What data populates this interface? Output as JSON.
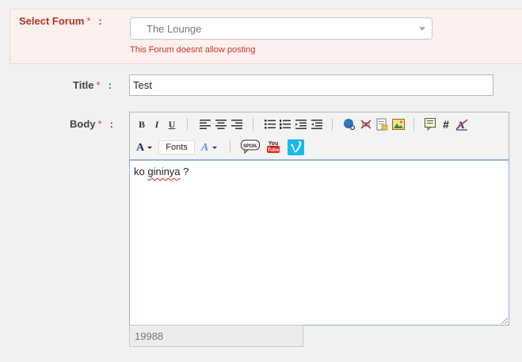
{
  "forum": {
    "label": "Select Forum",
    "required": "*",
    "colon": ":",
    "selected": "The Lounge",
    "error": "This Forum doesnt allow posting"
  },
  "title": {
    "label": "Title",
    "required": "*",
    "colon": ":",
    "value": "Test"
  },
  "body": {
    "label": "Body",
    "required": "*",
    "colon": ":",
    "content": "ko gininya ?",
    "misspelled": "gininya"
  },
  "toolbar": {
    "bold": "B",
    "italic": "I",
    "underline": "U",
    "hash": "#",
    "fonts": "Fonts",
    "spoil": "SPOIL",
    "youtube_top": "You",
    "youtube_bottom": "Tube"
  },
  "counter": {
    "value": "19988"
  },
  "colors": {
    "forum_label": "#b0362a",
    "required": "#e34234",
    "error": "#c0392b",
    "vimeo": "#1ab7ea",
    "youtube": "#e02020"
  }
}
